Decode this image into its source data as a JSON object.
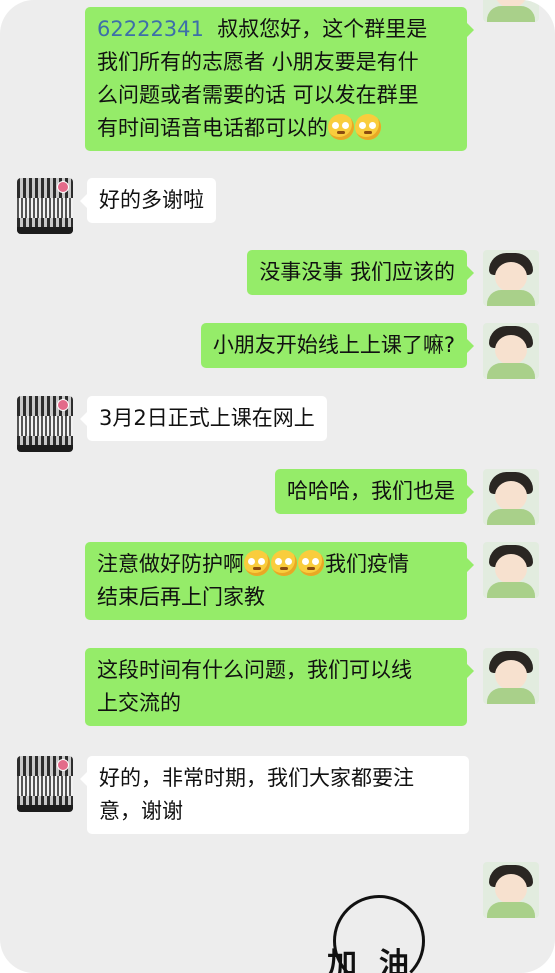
{
  "messages": [
    {
      "side": "out",
      "prefix": "62222341",
      "text": "叔叔您好，这个群里是\n我们所有的志愿者 小朋友要是有什\n么问题或者需要的话 可以发在群里\n有时间语音电话都可以的",
      "emoji_count": 2,
      "emoji": "dizzy-face-emoji"
    },
    {
      "side": "in",
      "text": "好的多谢啦"
    },
    {
      "side": "out",
      "text": "没事没事 我们应该的"
    },
    {
      "side": "out",
      "text": "小朋友开始线上上课了嘛?"
    },
    {
      "side": "in",
      "text": "3月2日正式上课在网上"
    },
    {
      "side": "out",
      "text": "哈哈哈，我们也是"
    },
    {
      "side": "out",
      "text_before": "注意做好防护啊",
      "emoji_count": 3,
      "emoji": "dizzy-face-emoji",
      "text_after": "我们疫情\n结束后再上门家教"
    },
    {
      "side": "out",
      "text": "这段时间有什么问题，我们可以线\n上交流的"
    },
    {
      "side": "in",
      "text": "好的，非常时期，我们大家都要注\n意，谢谢"
    }
  ],
  "watermark": {
    "text": "加油"
  },
  "avatars": {
    "incoming": "striped-pattern-avatar",
    "outgoing": "child-photo-avatar"
  },
  "colors": {
    "background": "#ededed",
    "outgoing_bubble": "#95ec69",
    "incoming_bubble": "#ffffff",
    "number_link": "#3d6fa8"
  }
}
